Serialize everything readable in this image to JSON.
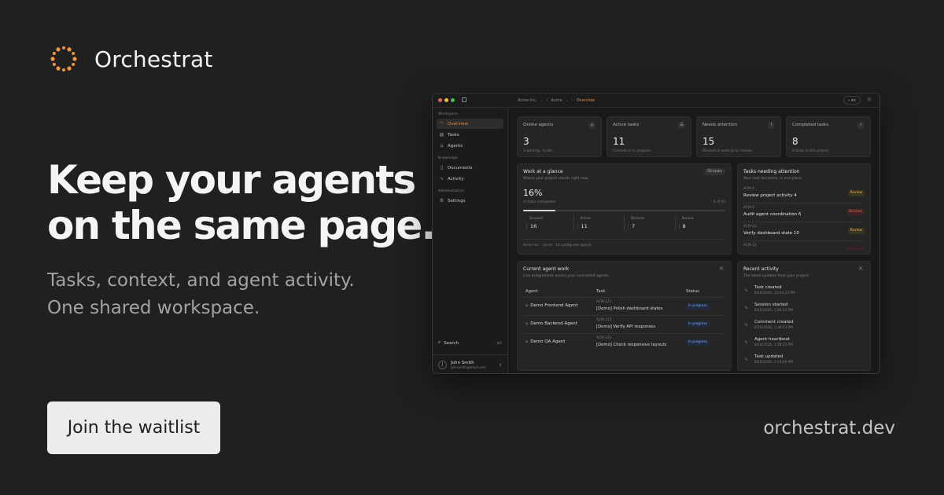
{
  "brand": {
    "name": "Orchestrat",
    "accent": "#f0953a"
  },
  "hero": {
    "headline": [
      "Keep your agents",
      "on the same page."
    ],
    "subline": [
      "Tasks, context, and agent activity.",
      "One shared workspace."
    ],
    "cta": "Join the waitlist",
    "domain": "orchestrat.dev"
  },
  "app": {
    "breadcrumbs": [
      "Acme Inc.",
      "Acme",
      "Overview"
    ],
    "search_label": "⌘K",
    "sidebar": {
      "sections": [
        {
          "title": "Workspace",
          "items": [
            {
              "label": "Overview",
              "icon": "gauge-icon",
              "active": true
            },
            {
              "label": "Tasks",
              "icon": "tasks-icon"
            },
            {
              "label": "Agents",
              "icon": "bot-icon"
            }
          ]
        },
        {
          "title": "Knowledge",
          "items": [
            {
              "label": "Documents",
              "icon": "document-icon"
            },
            {
              "label": "Activity",
              "icon": "activity-icon"
            }
          ]
        },
        {
          "title": "Administration",
          "items": [
            {
              "label": "Settings",
              "icon": "gear-icon"
            }
          ]
        }
      ],
      "search": {
        "label": "Search",
        "shortcut": "⌘K"
      },
      "user": {
        "initial": "J",
        "name": "John Smith",
        "email": "johnsmith@email.com"
      }
    },
    "stats": [
      {
        "label": "Online agents",
        "value": "3",
        "sub": "1 working · 0 idle",
        "icon": "bot-icon"
      },
      {
        "label": "Active tasks",
        "value": "11",
        "sub": "Claimed or in progress",
        "icon": "tasks-icon"
      },
      {
        "label": "Needs attention",
        "value": "15",
        "sub": "Blocked or waiting for review",
        "icon": "alert-icon"
      },
      {
        "label": "Completed tasks",
        "value": "8",
        "sub": "8 tasks in this project",
        "icon": "check-icon"
      }
    ],
    "glance": {
      "title": "Work at a glance",
      "subtitle": "Where your project stands right now.",
      "pill": "50 tasks",
      "percent": "16%",
      "percent_label": "of tasks completed",
      "fraction": "8 of 50",
      "progress": 0.16,
      "breakdown": [
        {
          "label": "Queued",
          "value": "16"
        },
        {
          "label": "Active",
          "value": "11"
        },
        {
          "label": "Blocked",
          "value": "7"
        },
        {
          "label": "Review",
          "value": "8"
        }
      ],
      "footer": "Acme Inc. · acme · 16 configured agents"
    },
    "attention": {
      "title": "Tasks needing attention",
      "subtitle": "Your next decisions, in one place.",
      "items": [
        {
          "code": "ACM-4",
          "title": "Review project activity 4",
          "badge": "Review",
          "kind": "review"
        },
        {
          "code": "ACM-6",
          "title": "Audit agent coordination 6",
          "badge": "Blocked",
          "kind": "blocked"
        },
        {
          "code": "ACM-10",
          "title": "Verify dashboard state 10",
          "badge": "Review",
          "kind": "review"
        },
        {
          "code": "ACM-12",
          "title": "",
          "badge": "",
          "kind": "blocked"
        }
      ]
    },
    "agent_work": {
      "title": "Current agent work",
      "subtitle": "Live assignments across your connected agents.",
      "columns": [
        "Agent",
        "Task",
        "Status"
      ],
      "rows": [
        {
          "agent": "Demo Frontend Agent",
          "code": "ACM-121",
          "task": "[Demo] Polish dashboard states",
          "status": "In progress"
        },
        {
          "agent": "Demo Backend Agent",
          "code": "ACM-122",
          "task": "[Demo] Verify API responses",
          "status": "In progress"
        },
        {
          "agent": "Demo QA Agent",
          "code": "ACM-123",
          "task": "[Demo] Check responsive layouts",
          "status": "In progress"
        }
      ]
    },
    "activity": {
      "title": "Recent activity",
      "subtitle": "The latest updates from your project.",
      "items": [
        {
          "title": "Task created",
          "time": "8/16/2026, 12:04:23 PM"
        },
        {
          "title": "Session started",
          "time": "8/16/2026, 1:09:03 PM"
        },
        {
          "title": "Comment created",
          "time": "8/16/2026, 1:38:03 PM"
        },
        {
          "title": "Agent heartbeat",
          "time": "8/16/2026, 1:39:33 PM"
        },
        {
          "title": "Task updated",
          "time": "8/16/2026, 1:54:09 PM"
        }
      ]
    }
  }
}
